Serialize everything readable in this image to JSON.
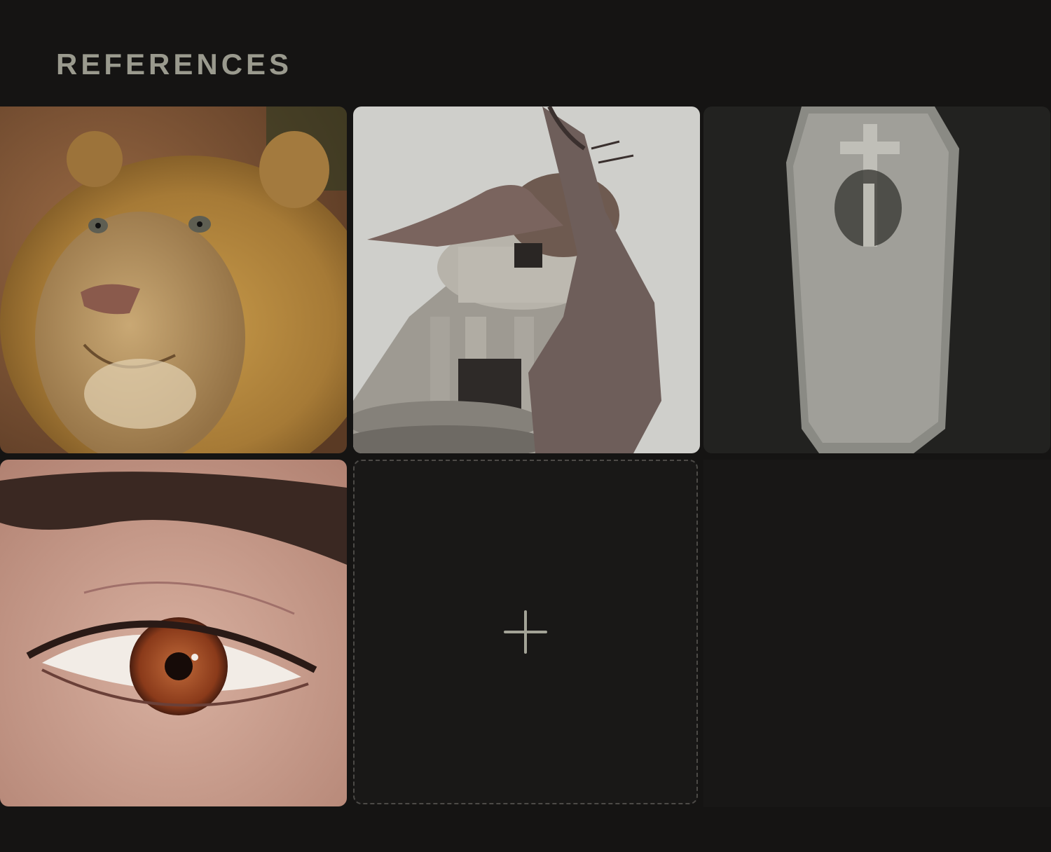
{
  "section": {
    "title": "REFERENCES"
  },
  "references": [
    {
      "name": "lion",
      "alt": "lion"
    },
    {
      "name": "dragon-building",
      "alt": "dragon-building"
    },
    {
      "name": "coffin-grave",
      "alt": "coffin-grave"
    },
    {
      "name": "eye",
      "alt": "eye"
    }
  ],
  "add_tile": {
    "icon": "plus-icon"
  },
  "colors": {
    "background": "#151413",
    "title": "#9a9a8e",
    "dashed_border": "#4c4a47",
    "plus": "#a3a397"
  }
}
